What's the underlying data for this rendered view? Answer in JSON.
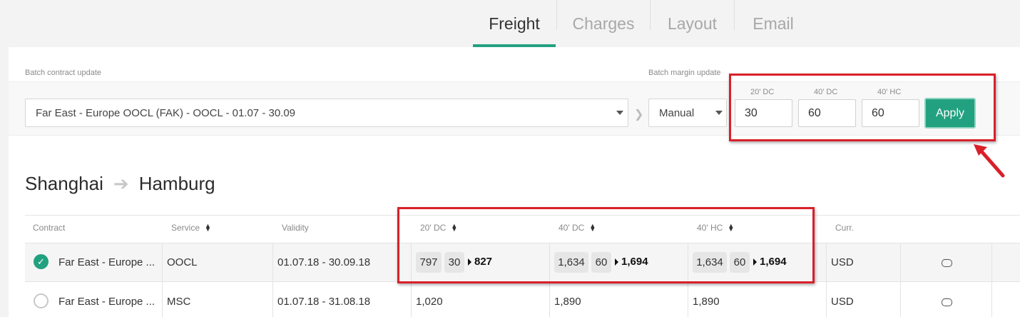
{
  "tabs": [
    {
      "label": "Freight",
      "active": true
    },
    {
      "label": "Charges",
      "active": false
    },
    {
      "label": "Layout",
      "active": false
    },
    {
      "label": "Email",
      "active": false
    }
  ],
  "batch": {
    "contract_label": "Batch contract update",
    "contract_value": "Far East - Europe OOCL (FAK) - OOCL - 01.07 - 30.09",
    "margin_label": "Batch margin update",
    "margin_mode": "Manual",
    "fields": [
      {
        "label": "20' DC",
        "value": "30"
      },
      {
        "label": "40' DC",
        "value": "60"
      },
      {
        "label": "40' HC",
        "value": "60"
      }
    ],
    "apply_label": "Apply"
  },
  "route": {
    "origin": "Shanghai",
    "destination": "Hamburg"
  },
  "table": {
    "headers": {
      "contract": "Contract",
      "service": "Service",
      "validity": "Validity",
      "dc20": "20' DC",
      "dc40": "40' DC",
      "hc40": "40' HC",
      "curr": "Curr."
    },
    "rows": [
      {
        "selected": true,
        "contract": "Far East - Europe ...",
        "service": "OOCL",
        "validity": "01.07.18 - 30.09.18",
        "dc20": {
          "base": "797",
          "margin": "30",
          "total": "827"
        },
        "dc40": {
          "base": "1,634",
          "margin": "60",
          "total": "1,694"
        },
        "hc40": {
          "base": "1,634",
          "margin": "60",
          "total": "1,694"
        },
        "curr": "USD"
      },
      {
        "selected": false,
        "contract": "Far East - Europe ...",
        "service": "MSC",
        "validity": "01.07.18 - 31.08.18",
        "dc20": "1,020",
        "dc40": "1,890",
        "hc40": "1,890",
        "curr": "USD"
      }
    ]
  },
  "colors": {
    "accent": "#22a180",
    "highlight": "#d9202a"
  },
  "icons": {
    "comment": "comment-icon",
    "sort": "sort-icon",
    "route_arrow": "arrow-right-icon"
  }
}
